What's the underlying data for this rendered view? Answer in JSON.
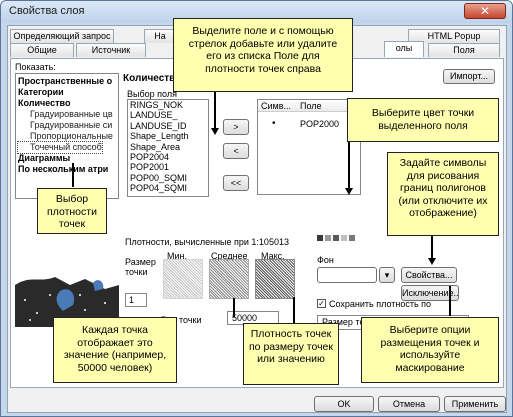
{
  "window": {
    "title": "Свойства слоя",
    "close": "✕"
  },
  "tabs_row1": [
    "Определяющий запрос",
    "На",
    "HTML Popup"
  ],
  "tabs_row2": [
    "Общие",
    "Источник",
    "олы",
    "Поля"
  ],
  "left": {
    "show_label": "Показать:",
    "tree": [
      "Пространственные о",
      "Категории",
      "Количество",
      "Градуированные цв",
      "Градуированные си",
      "Пропорциональные",
      "Точечный способ",
      "Диаграммы",
      "По нескольким атри"
    ]
  },
  "main": {
    "header": "Количество",
    "field_label": "Выбор поля",
    "import_button": "Импорт...",
    "fields": [
      "RINGS_NOK",
      "LANDUSE_",
      "LANDUSE_ID",
      "Shape_Length",
      "Shape_Area",
      "POP2004",
      "POP2001",
      "POP00_SQMI",
      "POP04_SQMI"
    ],
    "add_arrow": ">",
    "remove_arrow": "<",
    "remove_all": "<<",
    "table_headers": [
      "Симв...",
      "Поле"
    ],
    "table_row": {
      "symbol": "•",
      "field": "POP2000"
    },
    "density_label": "Плотности, вычисленные при 1:105013",
    "size_label": "Размер точки",
    "min_label": "Мин.",
    "mean_label": "Среднее",
    "max_label": "Макс.",
    "dot_size_value": "1",
    "dot_value_label": "Вес точки",
    "dot_value": "50000",
    "background_label": "Фон",
    "properties_button": "Свойства...",
    "exclusion_button": "Исключение...",
    "keep_density_label": "Сохранить плотность по",
    "keep_density_checked": true,
    "dot_size_combo": "Размер точки"
  },
  "buttons": {
    "ok": "OK",
    "cancel": "Отмена",
    "apply": "Применить"
  },
  "callouts": {
    "top": "Выделите поле и с помощью стрелок добавьте или удалите его из списка Поле для плотности точек справа",
    "color": "Выберите цвет точки выделенного поля",
    "symbols": "Задайте символы для рисования границ полигонов (или отключите их отображение)",
    "density_choice": "Выбор плотности точек",
    "dot_value": "Каждая точка отображает это значение (например, 50000 человек)",
    "density_size": "Плотность точек по размеру точек или значению",
    "options": "Выберите опции размещения точек и используйте маскирование"
  },
  "colors": {
    "callout_bg": "#ffffb0",
    "title_bg": "#c5d7ea",
    "swatches": [
      "#3a3a3a",
      "#9a9a9a",
      "#5a5a5a",
      "#c0c0c0",
      "#7a7a7a",
      "#202020"
    ]
  }
}
